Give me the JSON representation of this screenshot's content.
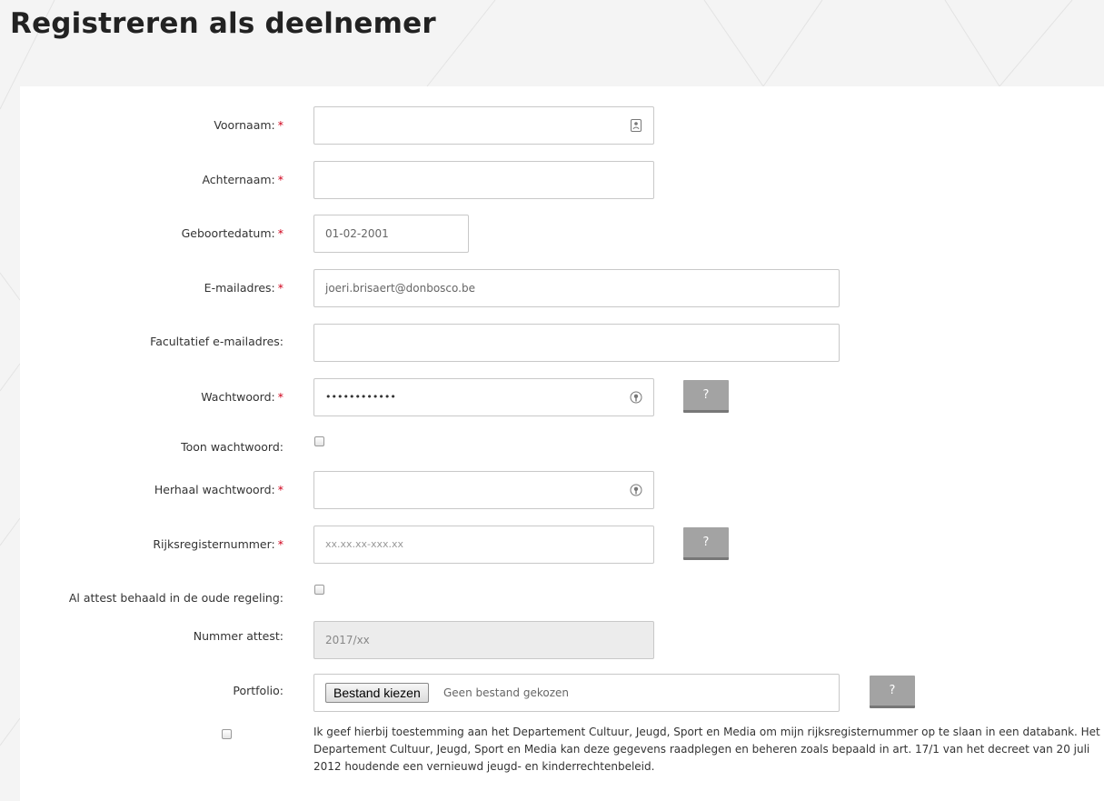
{
  "page": {
    "title": "Registreren als deelnemer"
  },
  "form": {
    "required_marker": "*",
    "help_label": "?",
    "voornaam": {
      "label": "Voornaam:",
      "value": ""
    },
    "achternaam": {
      "label": "Achternaam:",
      "value": ""
    },
    "geboortedatum": {
      "label": "Geboortedatum:",
      "value": "01-02-2001"
    },
    "email": {
      "label": "E-mailadres:",
      "value": "joeri.brisaert@donbosco.be"
    },
    "email_optional": {
      "label": "Facultatief e-mailadres:",
      "value": ""
    },
    "wachtwoord": {
      "label": "Wachtwoord:",
      "value": "••••••••••••"
    },
    "toon_wachtwoord": {
      "label": "Toon wachtwoord:",
      "checked": false
    },
    "herhaal_wachtwoord": {
      "label": "Herhaal wachtwoord:",
      "value": ""
    },
    "rijksregisternummer": {
      "label": "Rijksregisternummer:",
      "placeholder": "xx.xx.xx-xxx.xx"
    },
    "oude_regeling": {
      "label": "Al attest behaald in de oude regeling:",
      "checked": false
    },
    "nummer_attest": {
      "label": "Nummer attest:",
      "placeholder": "2017/xx",
      "disabled": true
    },
    "portfolio": {
      "label": "Portfolio:",
      "button": "Bestand kiezen",
      "status": "Geen bestand gekozen"
    },
    "consent": {
      "checked": false,
      "text": "Ik geef hierbij toestemming aan het Departement Cultuur, Jeugd, Sport en Media om mijn rijksregisternummer op te slaan in een databank. Het Departement Cultuur, Jeugd, Sport en Media kan deze gegevens raadplegen en beheren zoals bepaald in art. 17/1 van het decreet van 20 juli 2012 houdende een vernieuwd jeugd- en kinderrechtenbeleid."
    }
  },
  "colors": {
    "background": "#f4f4f4",
    "card": "#ffffff",
    "required": "#d0021b",
    "help_button": "#a3a3a3",
    "disabled_input": "#ececec"
  },
  "icons": {
    "voornaam": "contact-card-icon",
    "wachtwoord": "key-icon",
    "herhaal_wachtwoord": "key-icon"
  }
}
